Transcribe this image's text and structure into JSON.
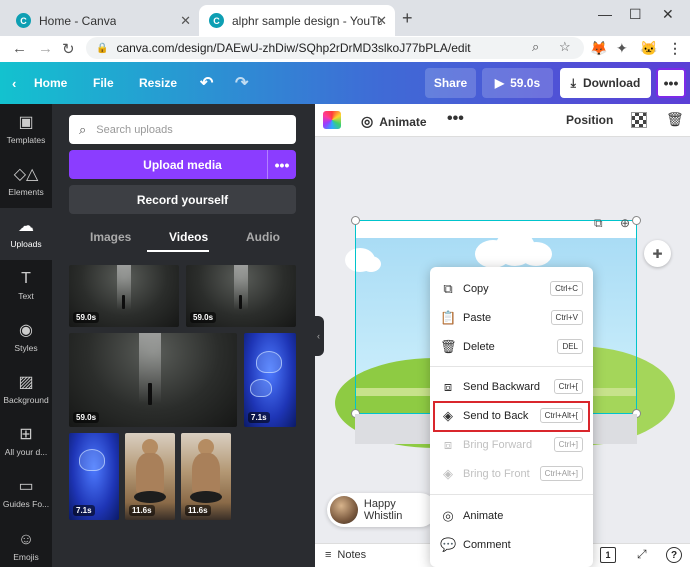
{
  "browser": {
    "tabs": [
      {
        "title": "Home - Canva",
        "active": false
      },
      {
        "title": "alphr sample design - YouTube T",
        "active": true
      }
    ],
    "url": "canva.com/design/DAEwU-zhDiw/SQhp2rDrMD3slkoJ77bPLA/edit"
  },
  "header": {
    "home_label": "Home",
    "file_label": "File",
    "resize_label": "Resize",
    "share_label": "Share",
    "duration_label": "59.0s",
    "download_label": "Download",
    "more_label": "•••"
  },
  "rail": {
    "items": [
      {
        "label": "Templates"
      },
      {
        "label": "Elements"
      },
      {
        "label": "Uploads"
      },
      {
        "label": "Text"
      },
      {
        "label": "Styles"
      },
      {
        "label": "Background"
      },
      {
        "label": "All your d..."
      },
      {
        "label": "Guides Fo..."
      },
      {
        "label": "Emojis"
      }
    ]
  },
  "panel": {
    "search_placeholder": "Search uploads",
    "upload_label": "Upload media",
    "upload_more": "•••",
    "record_label": "Record yourself",
    "tabs": [
      {
        "label": "Images"
      },
      {
        "label": "Videos"
      },
      {
        "label": "Audio"
      }
    ],
    "videos": [
      {
        "duration": "59.0s"
      },
      {
        "duration": "59.0s"
      },
      {
        "duration": "59.0s"
      },
      {
        "duration": "7.1s"
      },
      {
        "duration": "7.1s"
      },
      {
        "duration": "11.6s"
      },
      {
        "duration": "11.6s"
      }
    ]
  },
  "toolbar": {
    "animate_label": "Animate",
    "more_label": "•••",
    "position_label": "Position"
  },
  "profile": {
    "name": "Happy Whistlin"
  },
  "bottom": {
    "notes_label": "Notes",
    "page_number": "1"
  },
  "context_menu": {
    "items": [
      {
        "label": "Copy",
        "shortcut": "Ctrl+C"
      },
      {
        "label": "Paste",
        "shortcut": "Ctrl+V"
      },
      {
        "label": "Delete",
        "shortcut": "DEL"
      },
      {
        "label": "Send Backward",
        "shortcut": "Ctrl+["
      },
      {
        "label": "Send to Back",
        "shortcut": "Ctrl+Alt+["
      },
      {
        "label": "Bring Forward",
        "shortcut": "Ctrl+]"
      },
      {
        "label": "Bring to Front",
        "shortcut": "Ctrl+Alt+]"
      },
      {
        "label": "Animate"
      },
      {
        "label": "Comment"
      }
    ]
  },
  "colors": {
    "brand_purple": "#8b3dff",
    "highlight_red": "#d9262c",
    "selection_teal": "#00c4cc"
  }
}
